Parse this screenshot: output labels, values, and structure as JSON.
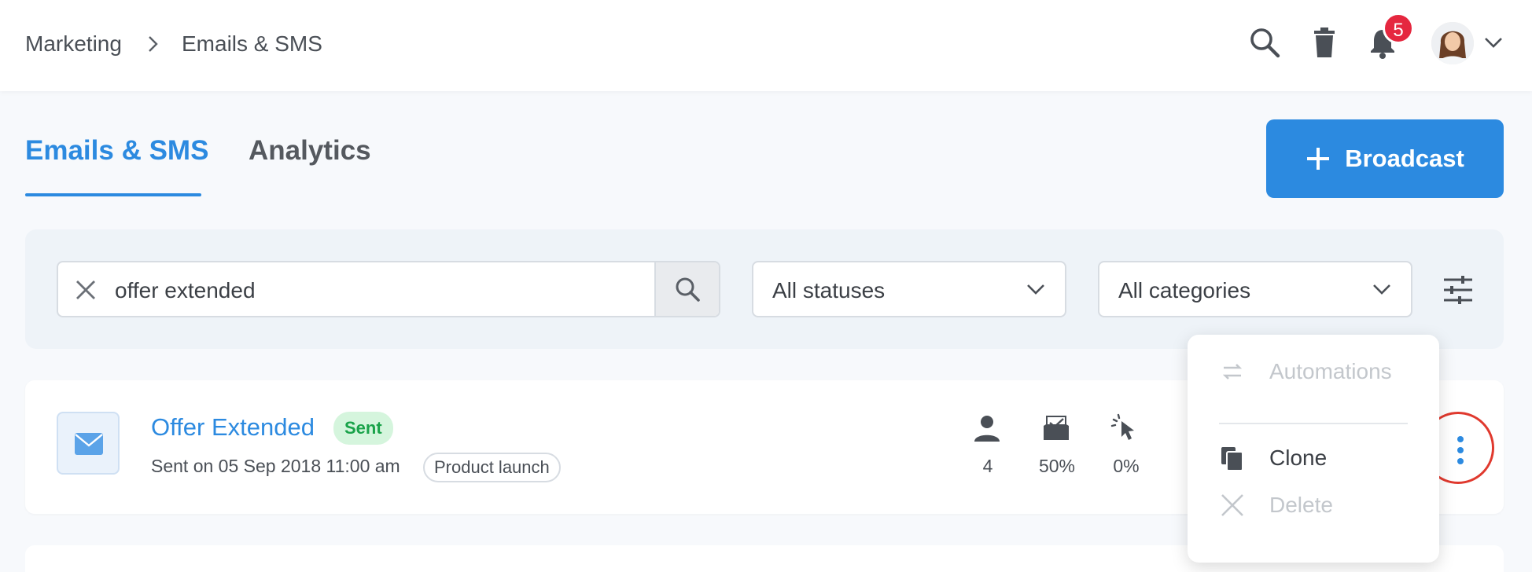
{
  "breadcrumb": {
    "parent": "Marketing",
    "current": "Emails & SMS"
  },
  "header": {
    "notification_count": "5",
    "icons": [
      "search-icon",
      "trash-icon",
      "bell-icon",
      "avatar",
      "chevron-down-icon"
    ]
  },
  "tabs": [
    {
      "label": "Emails & SMS",
      "active": true
    },
    {
      "label": "Analytics",
      "active": false
    }
  ],
  "actions": {
    "broadcast_label": "Broadcast"
  },
  "filters": {
    "search_value": "offer extended",
    "status_select": "All statuses",
    "category_select": "All categories"
  },
  "campaigns": [
    {
      "title": "Offer Extended",
      "status": "Sent",
      "sent_on": "Sent on 05 Sep 2018 11:00 am",
      "category": "Product launch",
      "stats": {
        "recipients": "4",
        "opens": "50%",
        "clicks": "0%"
      }
    }
  ],
  "context_menu": {
    "items": [
      {
        "label": "Automations",
        "disabled": true
      },
      {
        "label": "Clone",
        "disabled": false
      },
      {
        "label": "Delete",
        "disabled": true
      }
    ]
  },
  "colors": {
    "accent": "#2c8ae0",
    "badge": "#e5273f",
    "sent_bg": "#d5f5dd",
    "sent_text": "#1aa34a",
    "highlight_ring": "#e0392e"
  }
}
